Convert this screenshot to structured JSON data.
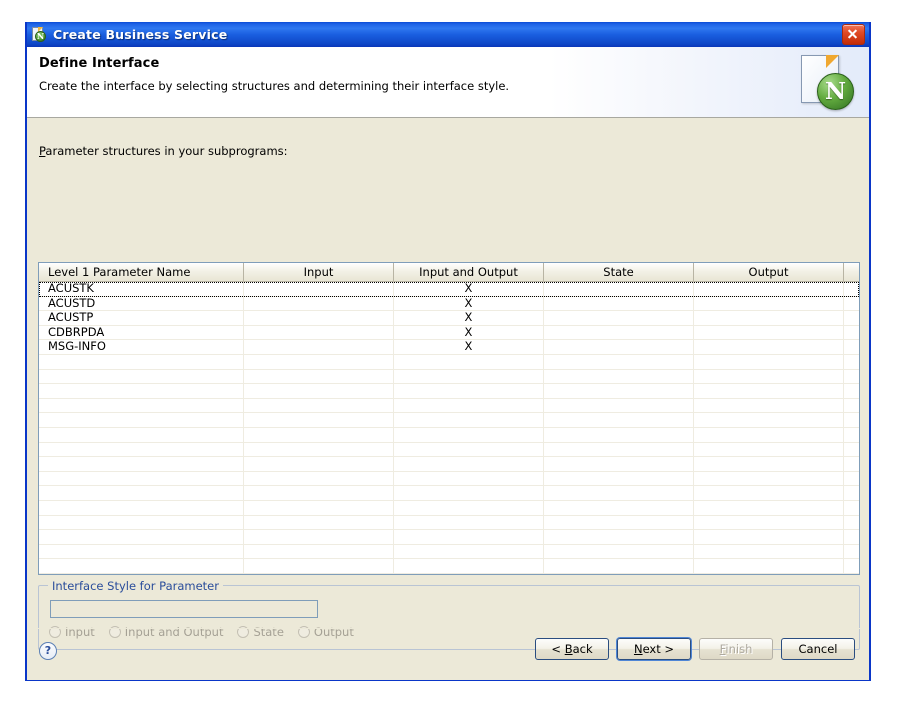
{
  "window": {
    "title": "Create Business Service",
    "icon": "document-n-icon",
    "close_label": "Close"
  },
  "header": {
    "title": "Define Interface",
    "description": "Create the interface by selecting structures and determining their interface style.",
    "icon": "natural-document-icon",
    "icon_letter": "N"
  },
  "table": {
    "label_prefix": "P",
    "label_rest": "arameter structures in your subprograms:",
    "columns": [
      "Level 1 Parameter Name",
      "Input",
      "Input and Output",
      "State",
      "Output",
      ""
    ],
    "rows": [
      {
        "name": "ACUSTK",
        "input": "",
        "input_and_output": "X",
        "state": "",
        "output": "",
        "extra": "",
        "focused": true
      },
      {
        "name": "ACUSTD",
        "input": "",
        "input_and_output": "X",
        "state": "",
        "output": "",
        "extra": "",
        "focused": false
      },
      {
        "name": "ACUSTP",
        "input": "",
        "input_and_output": "X",
        "state": "",
        "output": "",
        "extra": "",
        "focused": false
      },
      {
        "name": "CDBRPDA",
        "input": "",
        "input_and_output": "X",
        "state": "",
        "output": "",
        "extra": "",
        "focused": false
      },
      {
        "name": "MSG-INFO",
        "input": "",
        "input_and_output": "X",
        "state": "",
        "output": "",
        "extra": "",
        "focused": false
      }
    ],
    "empty_row_count": 15
  },
  "interface_style": {
    "group_title": "Interface Style for Parameter",
    "field_value": "",
    "field_placeholder": "",
    "radios": [
      {
        "label": "Input",
        "selected": false,
        "disabled": true
      },
      {
        "label": "Input and Output",
        "selected": false,
        "disabled": true
      },
      {
        "label": "State",
        "selected": false,
        "disabled": true
      },
      {
        "label": "Output",
        "selected": false,
        "disabled": true
      }
    ]
  },
  "footer": {
    "help_label": "?",
    "buttons": [
      {
        "name": "back",
        "prefix": "< ",
        "mnemonic": "B",
        "suffix": "ack",
        "disabled": false,
        "default": false
      },
      {
        "name": "next",
        "prefix": "",
        "mnemonic": "N",
        "suffix": "ext >",
        "disabled": false,
        "default": true
      },
      {
        "name": "finish",
        "prefix": "",
        "mnemonic": "F",
        "suffix": "inish",
        "disabled": true,
        "default": false
      },
      {
        "name": "cancel",
        "prefix": "",
        "mnemonic": "",
        "suffix": "Cancel",
        "disabled": false,
        "default": false
      }
    ]
  },
  "colors": {
    "titlebar_blue": "#1e62e6",
    "dialog_border": "#0a36c8",
    "body_beige": "#ece9d8",
    "group_title_blue": "#2a4d9b",
    "grid_border": "#7f9db9",
    "close_red": "#c32c08"
  }
}
